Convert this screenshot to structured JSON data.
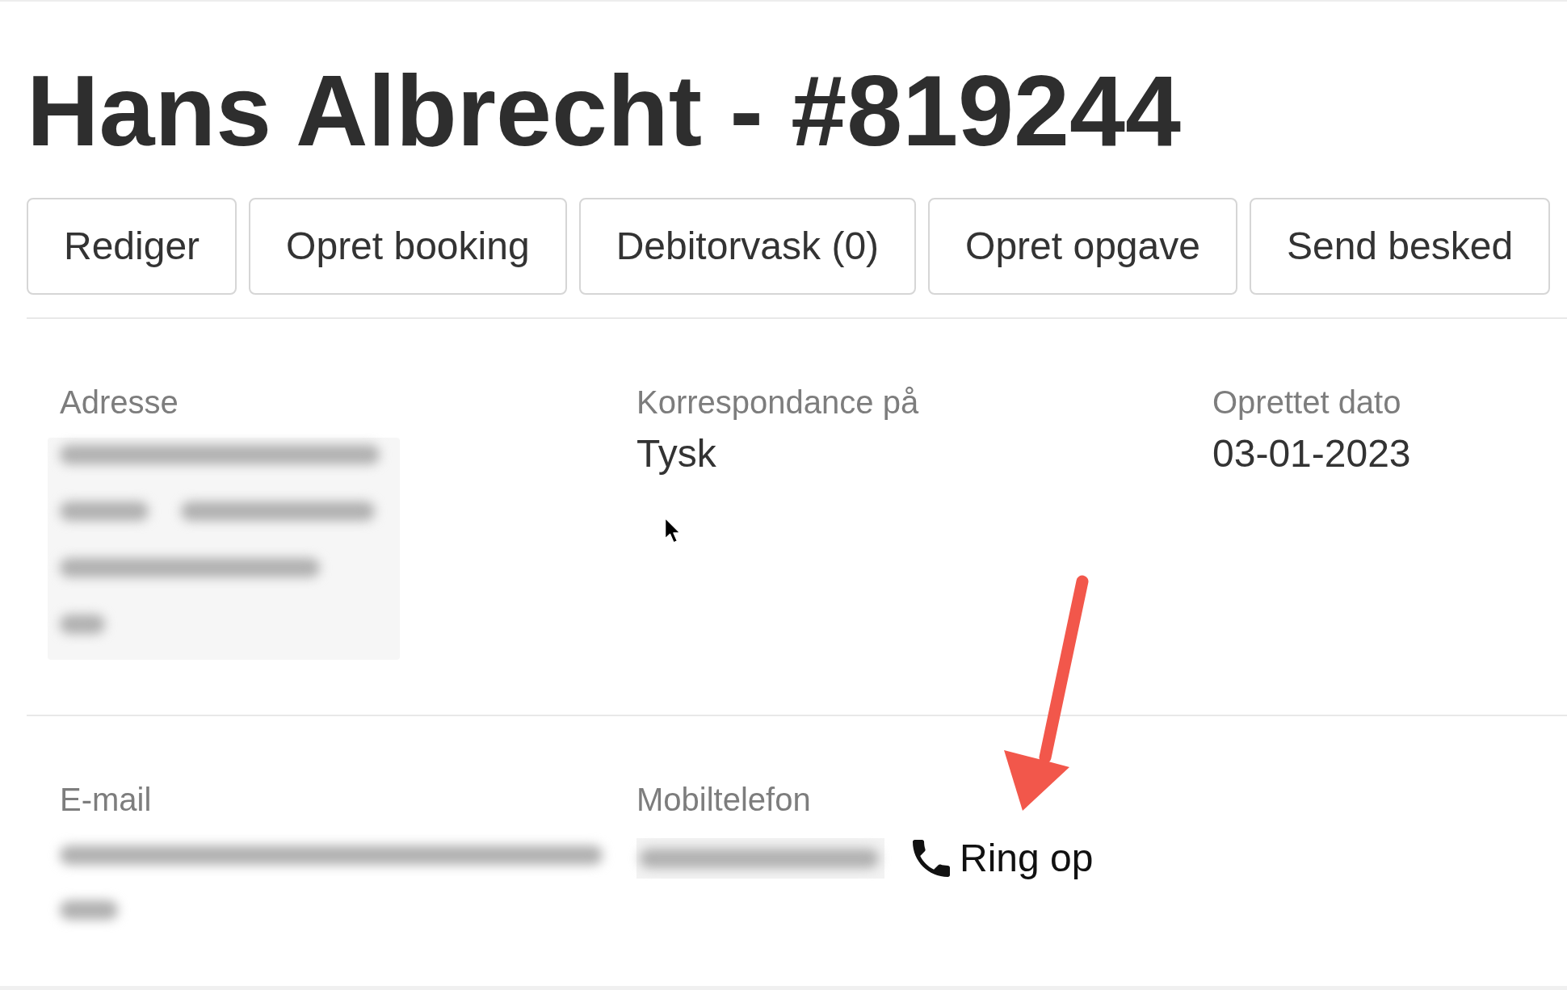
{
  "title": "Hans Albrecht - #819244",
  "actions": [
    "Rediger",
    "Opret booking",
    "Debitorvask (0)",
    "Opret opgave",
    "Send besked"
  ],
  "sections": [
    {
      "fields": [
        {
          "kind": "address",
          "label": "Adresse"
        },
        {
          "kind": "text",
          "label": "Korrespondance på",
          "value": "Tysk"
        },
        {
          "kind": "text",
          "label": "Oprettet dato",
          "value": "03-01-2023"
        }
      ]
    },
    {
      "fields": [
        {
          "kind": "email",
          "label": "E-mail"
        },
        {
          "kind": "phone",
          "label": "Mobiltelefon",
          "action": "Ring op"
        }
      ]
    }
  ]
}
